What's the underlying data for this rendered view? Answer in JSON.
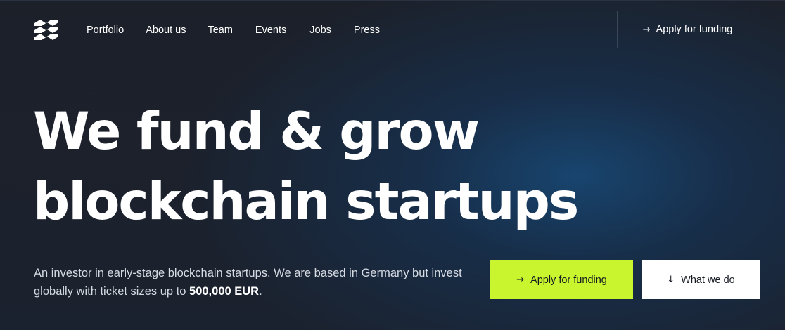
{
  "nav": {
    "items": [
      {
        "label": "Portfolio"
      },
      {
        "label": "About us"
      },
      {
        "label": "Team"
      },
      {
        "label": "Events"
      },
      {
        "label": "Jobs"
      },
      {
        "label": "Press"
      }
    ],
    "cta_label": "Apply for funding",
    "cta_icon": "arrow-right-icon"
  },
  "hero": {
    "headline_line1": "We fund & grow",
    "headline_line2": "blockchain startups",
    "subtext_part1": "An investor in early-stage blockchain startups. We are based in Germany but invest globally with ticket sizes up to ",
    "subtext_highlight": "500,000 EUR",
    "subtext_end": ".",
    "primary_button": {
      "label": "Apply for funding",
      "icon": "arrow-right-icon"
    },
    "secondary_button": {
      "label": "What we do",
      "icon": "arrow-down-icon"
    }
  },
  "colors": {
    "background": "#1a1f2b",
    "accent_glow": "#174b7a",
    "primary_button": "#c8f52e",
    "secondary_button": "#ffffff",
    "text": "#ffffff"
  },
  "icons": {
    "arrow_right": "→",
    "arrow_down": "↓"
  }
}
